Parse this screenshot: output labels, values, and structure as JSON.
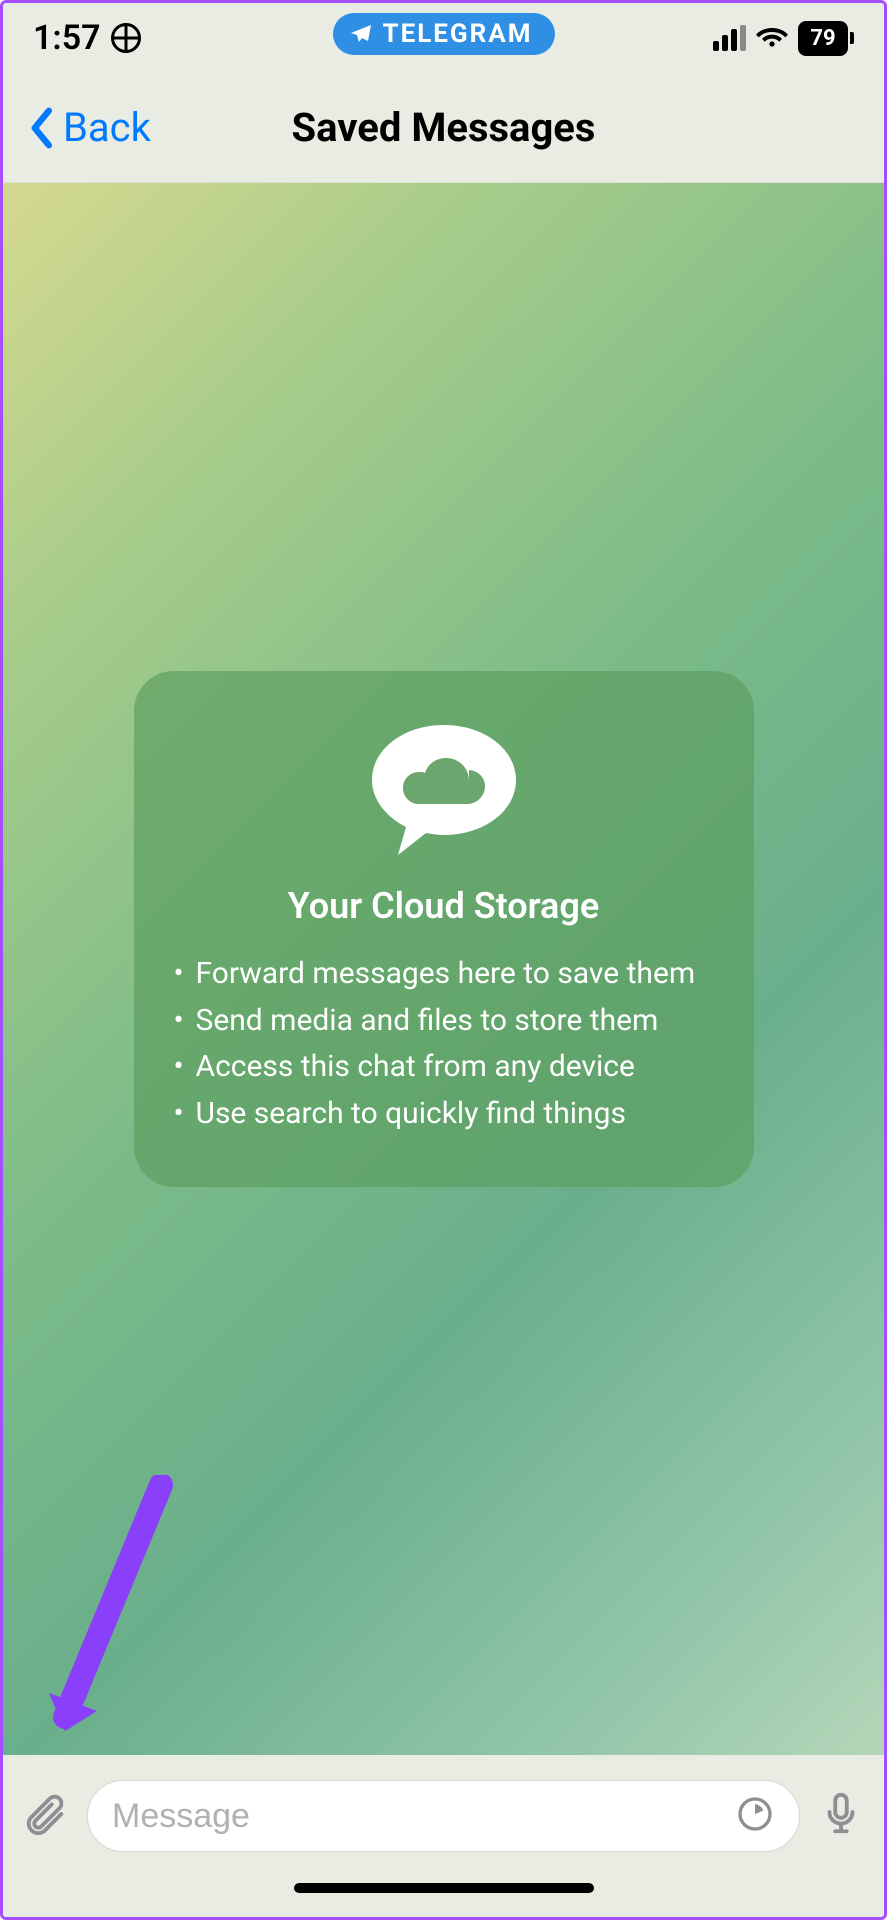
{
  "status": {
    "time": "1:57",
    "battery": "79",
    "app_pill": "TELEGRAM"
  },
  "nav": {
    "back_label": "Back",
    "title": "Saved Messages"
  },
  "info_card": {
    "title": "Your Cloud Storage",
    "bullets": [
      "Forward messages here to save them",
      "Send media and files to store them",
      "Access this chat from any device",
      "Use search to quickly find things"
    ]
  },
  "input": {
    "placeholder": "Message",
    "value": ""
  },
  "colors": {
    "accent": "#007aff",
    "annotation": "#8a3ffb"
  }
}
